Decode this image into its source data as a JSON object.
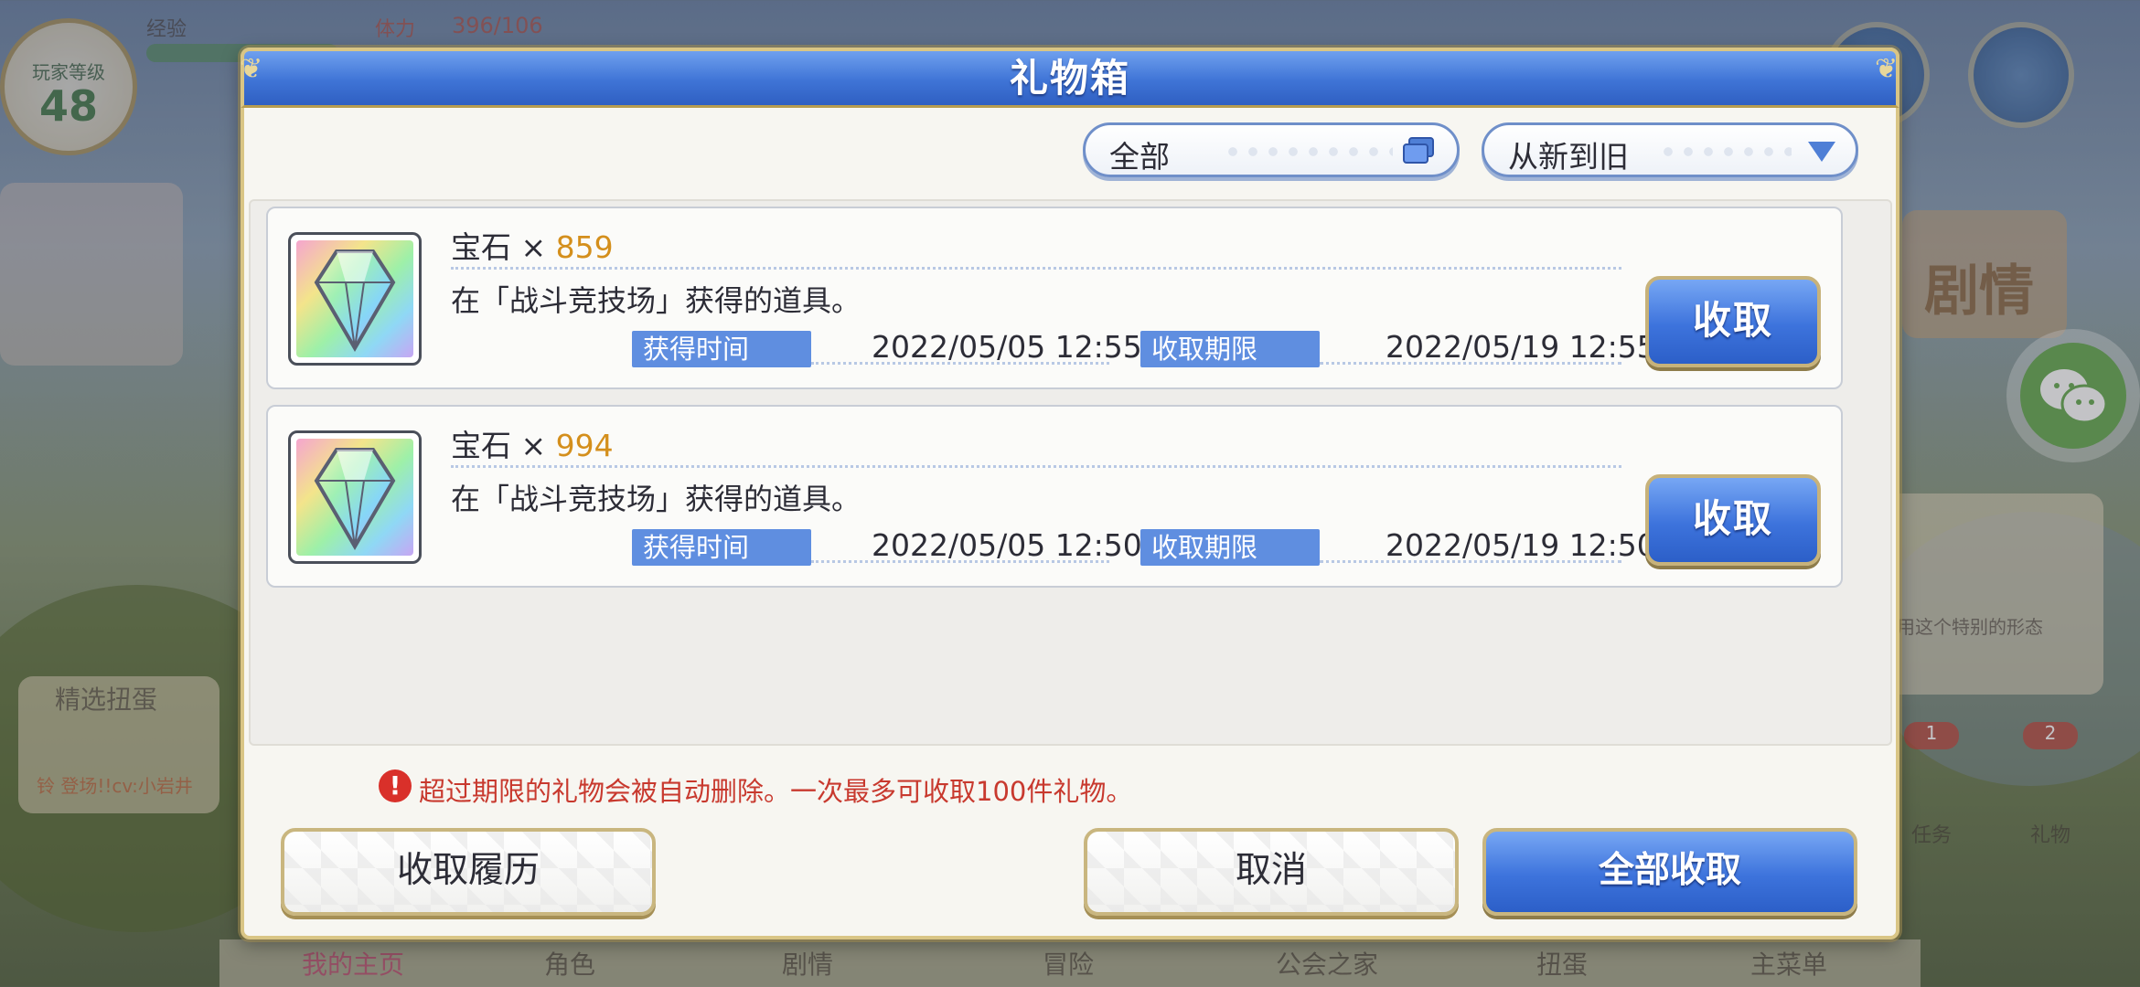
{
  "background": {
    "player_level_label": "玩家等级",
    "player_level": "48",
    "stamina_label": "体力",
    "stamina_value": "396/106",
    "rank_label": "经验",
    "event_banner": "精选扭蛋",
    "event_sub": "铃 登场!!cv:小岩井",
    "bulletin_text": "用这个特别的形态",
    "nav": [
      "我的主页",
      "角色",
      "剧情",
      "冒险",
      "公会之家",
      "扭蛋",
      "主菜单"
    ],
    "side_badges": [
      "1",
      "2"
    ],
    "side_labels": [
      "任务",
      "礼物"
    ],
    "banner_story": "剧情"
  },
  "dialog": {
    "title": "礼物箱",
    "filter": {
      "selected": "全部",
      "icon": "window-stack-icon"
    },
    "sort": {
      "selected": "从新到旧",
      "icon": "triangle-down-icon"
    },
    "items": [
      {
        "name": "宝石",
        "times": "×",
        "qty": "859",
        "desc": "在「战斗竞技场」获得的道具。",
        "received_label": "获得时间",
        "received": "2022/05/05  12:55",
        "expire_label": "收取期限",
        "expire": "2022/05/19  12:55",
        "claim_label": "收取",
        "icon": "gem-icon"
      },
      {
        "name": "宝石",
        "times": "×",
        "qty": "994",
        "desc": "在「战斗竞技场」获得的道具。",
        "received_label": "获得时间",
        "received": "2022/05/05  12:50",
        "expire_label": "收取期限",
        "expire": "2022/05/19  12:50",
        "claim_label": "收取",
        "icon": "gem-icon"
      }
    ],
    "warning_mark": "!",
    "warning": "超过期限的礼物会被自动删除。一次最多可收取100件礼物。",
    "history_button": "收取履历",
    "cancel_button": "取消",
    "claim_all_button": "全部收取"
  },
  "colors": {
    "title_blue": "#3f74d6",
    "tag_blue": "#5f8ee0",
    "qty_gold": "#d48f1c",
    "warning_red": "#c8392e",
    "frame_gold": "#d9c585"
  }
}
